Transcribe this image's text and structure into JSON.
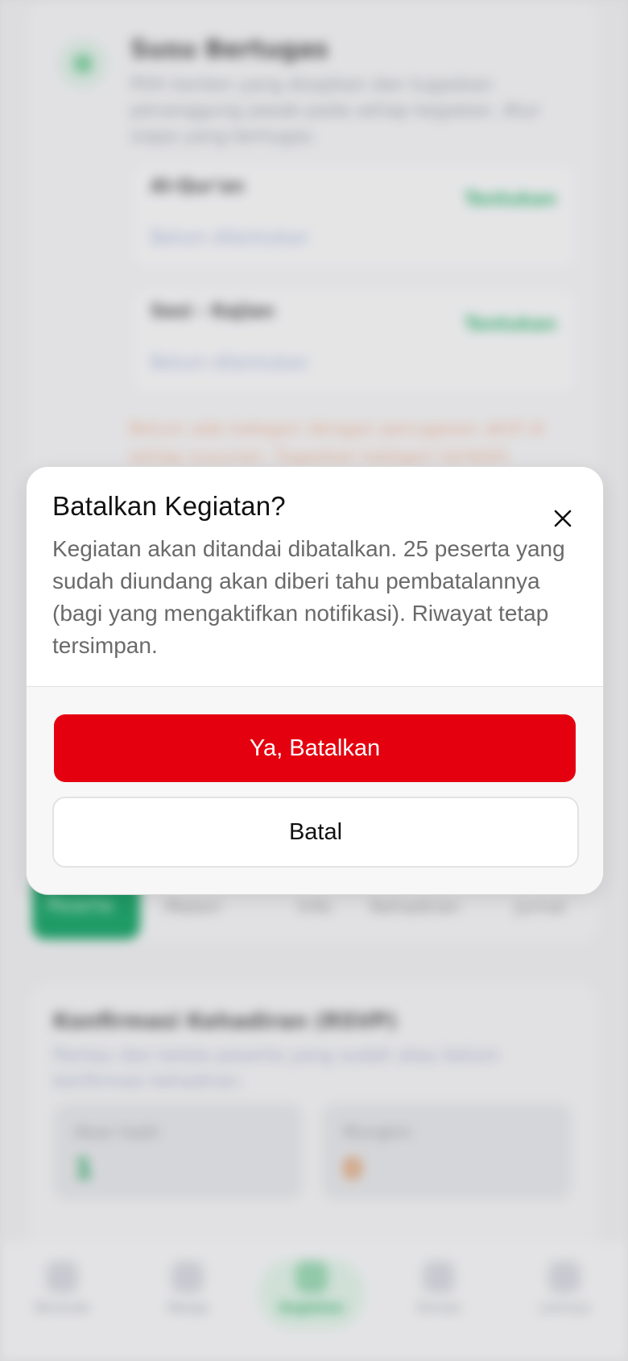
{
  "background": {
    "section": {
      "title": "Susu Bertugas",
      "description": "Pilih konten yang disajikan dan tugaskan penanggung jawab pada setiap kegiatan. Atur siapa yang bertugas."
    },
    "assignments": [
      {
        "name": "Al-Qur'an",
        "status": "Tentukan",
        "assignee": "Belum ditentukan"
      },
      {
        "name": "Sesi - Kajian",
        "status": "Tentukan",
        "assignee": "Belum ditentukan"
      }
    ],
    "warning": "Belum ada kategori dengan penugasan aktif di setiap susunan. Tugaskan kategori terlebih dahulu.",
    "tabs": [
      "Peserta",
      "Materi",
      "Info",
      "Kehadiran",
      "Jurnal"
    ],
    "rsvp": {
      "title": "Konfirmasi Kehadiran (RSVP)",
      "description": "Pantau dan kelola peserta yang sudah atau belum konfirmasi kehadiran.",
      "stats": [
        {
          "label": "Akan hadir",
          "value": "1",
          "color": "#2aa866"
        },
        {
          "label": "Mungkin",
          "value": "0",
          "color": "#e08a4a"
        }
      ]
    },
    "bottom_nav": [
      {
        "label": "Beranda",
        "icon": "home-icon",
        "active": false
      },
      {
        "label": "Warga",
        "icon": "users-icon",
        "active": false
      },
      {
        "label": "Kegiatan",
        "icon": "calendar-icon",
        "active": true
      },
      {
        "label": "Donasi",
        "icon": "donation-icon",
        "active": false
      },
      {
        "label": "Lainnya",
        "icon": "menu-icon",
        "active": false
      }
    ]
  },
  "modal": {
    "title": "Batalkan Kegiatan?",
    "body": "Kegiatan akan ditandai dibatalkan. 25 peserta yang sudah diundang akan diberi tahu pembatalannya (bagi yang mengaktifkan notifikasi). Riwayat tetap tersimpan.",
    "confirm_label": "Ya, Batalkan",
    "cancel_label": "Batal",
    "close_icon": "close-icon"
  },
  "colors": {
    "danger": "#e5000f",
    "accent": "#1aa468"
  }
}
